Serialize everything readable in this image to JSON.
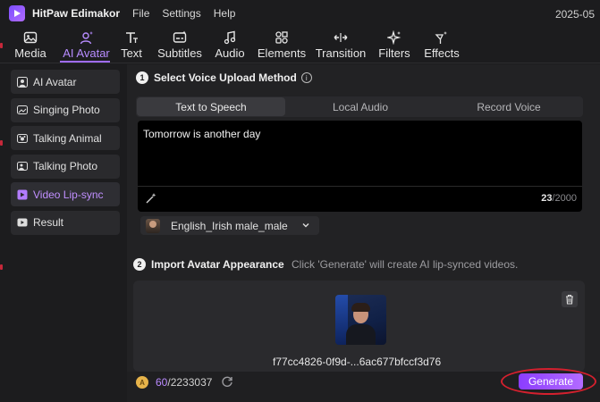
{
  "window": {
    "app_title": "HitPaw Edimakor",
    "date": "2025-05"
  },
  "menu": [
    "File",
    "Settings",
    "Help"
  ],
  "toolbar": {
    "tools": [
      {
        "label": "Media",
        "icon": "image-icon"
      },
      {
        "label": "AI Avatar",
        "icon": "avatar-sparkle-icon"
      },
      {
        "label": "Text",
        "icon": "text-icon"
      },
      {
        "label": "Subtitles",
        "icon": "subtitles-icon"
      },
      {
        "label": "Audio",
        "icon": "music-note-icon"
      },
      {
        "label": "Elements",
        "icon": "elements-icon"
      },
      {
        "label": "Transition",
        "icon": "transition-arrows-icon"
      },
      {
        "label": "Filters",
        "icon": "sparkle-icon"
      },
      {
        "label": "Effects",
        "icon": "magic-wand-icon"
      }
    ],
    "active": "AI Avatar"
  },
  "sidebar": {
    "items": [
      {
        "label": "AI Avatar"
      },
      {
        "label": "Singing Photo"
      },
      {
        "label": "Talking Animal"
      },
      {
        "label": "Talking Photo"
      },
      {
        "label": "Video Lip-sync"
      },
      {
        "label": "Result"
      }
    ],
    "active": "Video Lip-sync"
  },
  "step1": {
    "number": "1",
    "title": "Select Voice Upload Method"
  },
  "voice_tabs": [
    "Text to Speech",
    "Local Audio",
    "Record Voice"
  ],
  "text_input": {
    "value": "Tomorrow is another day",
    "count": "23",
    "max": "/2000"
  },
  "voice_select": {
    "value": "English_Irish male_male"
  },
  "step2": {
    "number": "2",
    "title": "Import Avatar Appearance",
    "hint": "Click 'Generate' will create AI lip-synced videos."
  },
  "avatar": {
    "file_name": "f77cc4826-0f9d-...6ac677bfccf3d76"
  },
  "credits": {
    "used": "60",
    "total": "/2233037"
  },
  "generate_button": {
    "label": "Generate"
  },
  "colors": {
    "accent": "#a06cff",
    "button": "#9a4dff",
    "highlight": "#d4202e"
  }
}
